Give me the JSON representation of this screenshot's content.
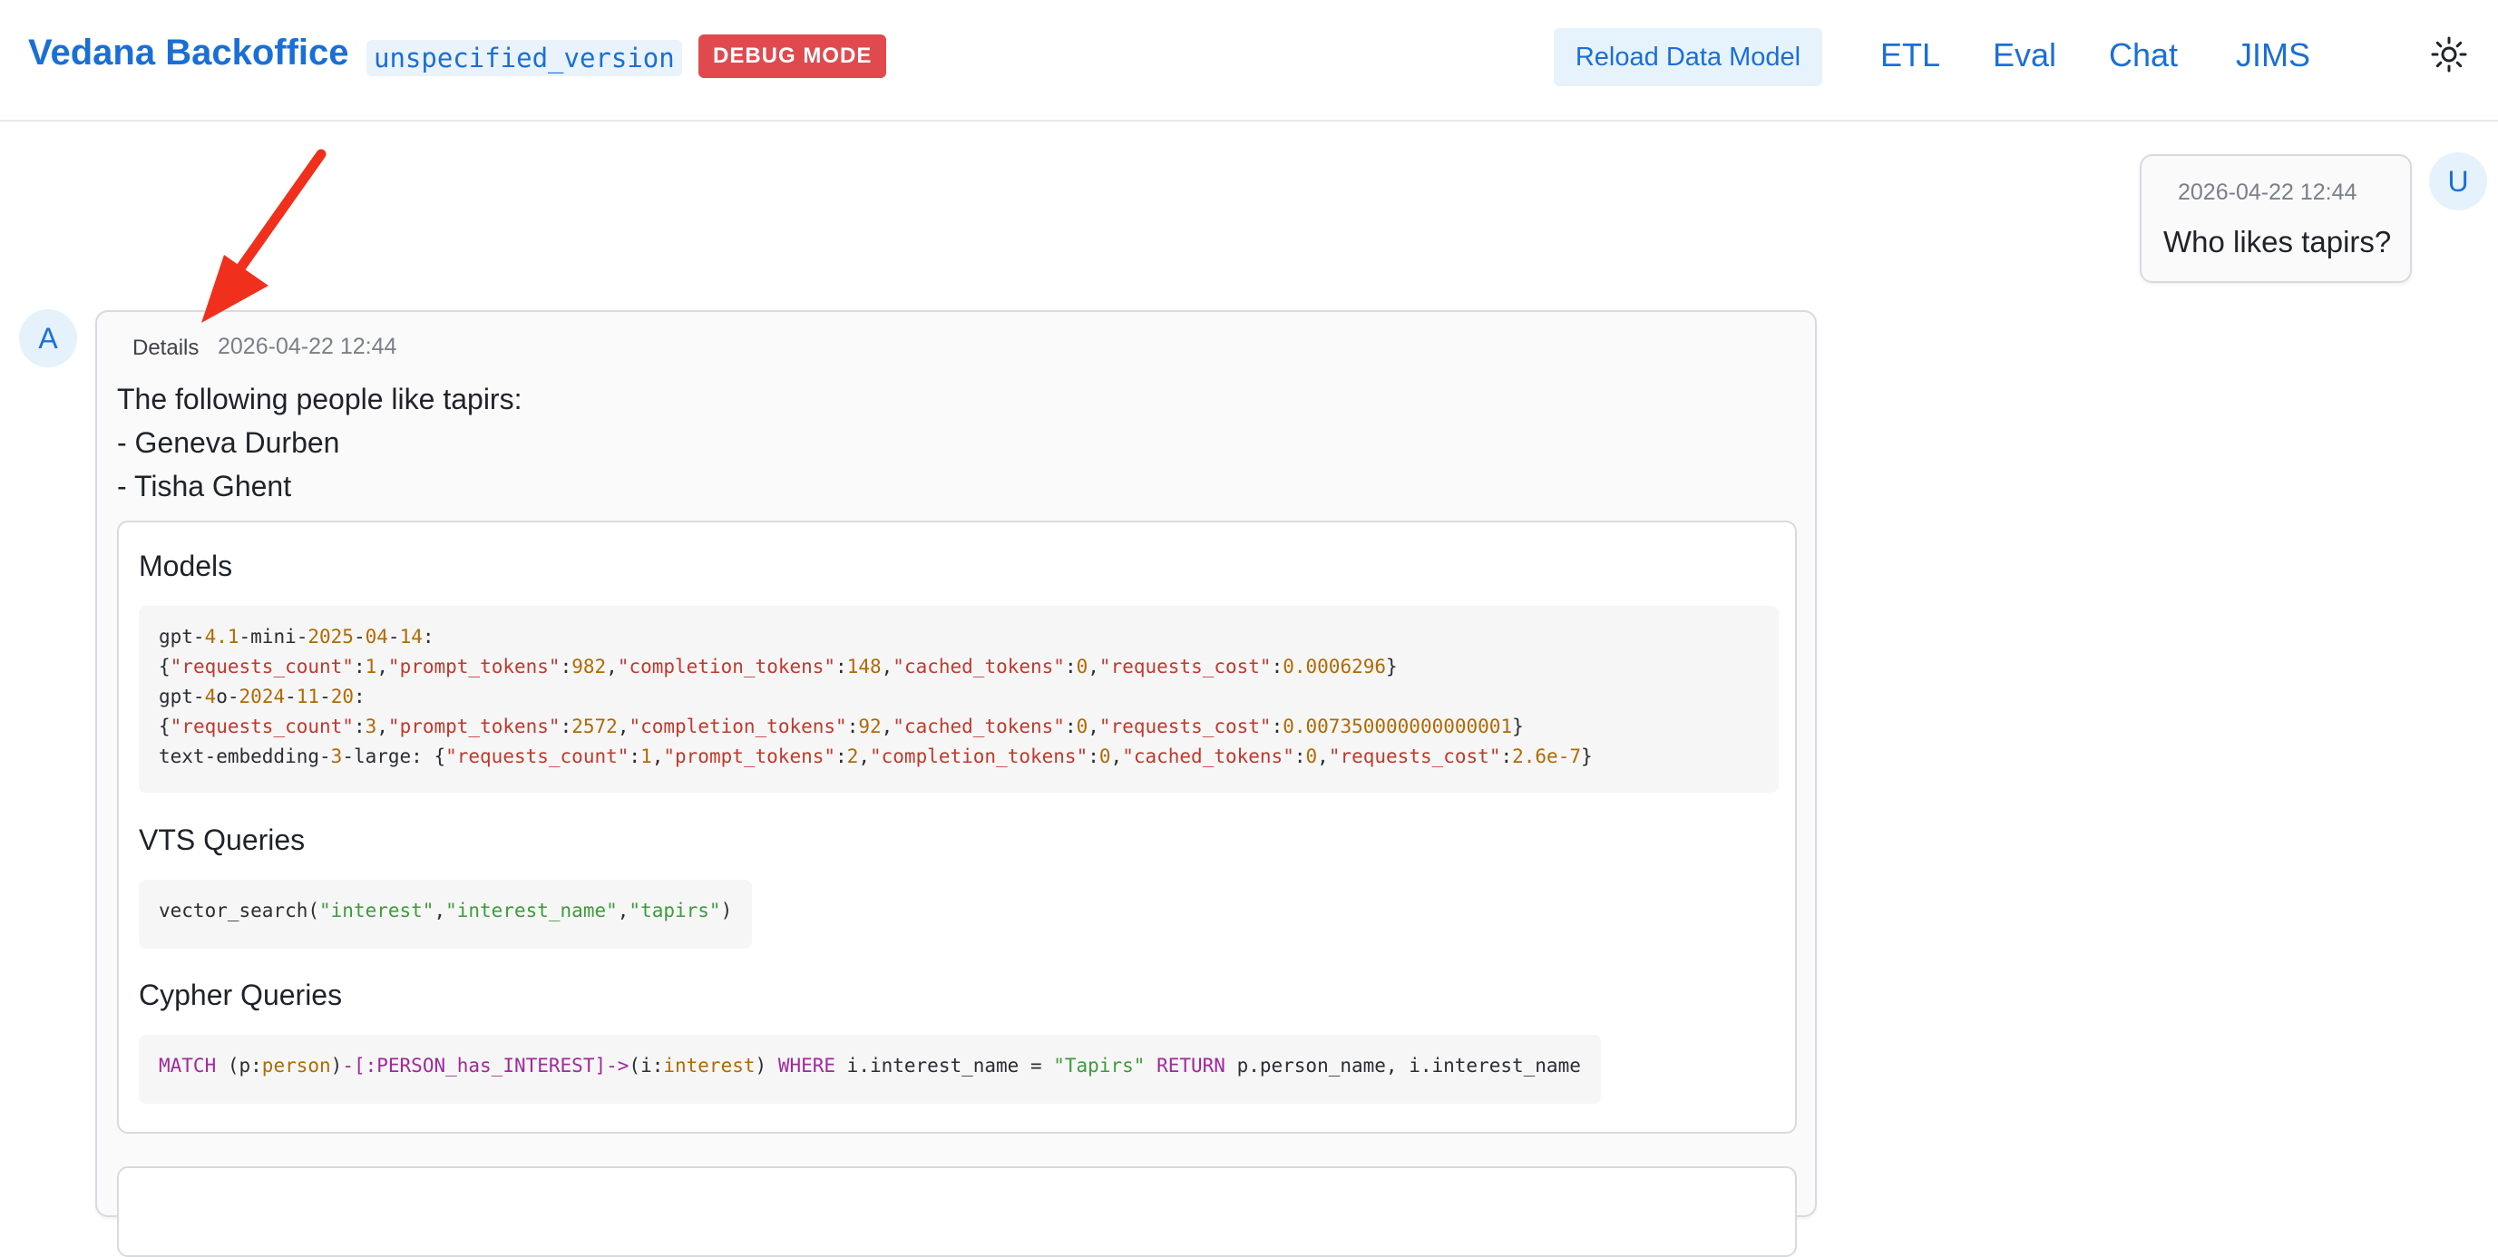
{
  "header": {
    "brand": "Vedana Backoffice",
    "version": "unspecified_version",
    "debug_badge": "DEBUG MODE",
    "reload_button": "Reload Data Model",
    "nav": [
      "ETL",
      "Eval",
      "Chat",
      "JIMS"
    ],
    "theme_icon": "sun-icon"
  },
  "user_message": {
    "avatar": "U",
    "timestamp": "2026-04-22 12:44",
    "text": "Who likes tapirs?"
  },
  "assistant_message": {
    "avatar": "A",
    "details_label": "Details",
    "timestamp": "2026-04-22 12:44",
    "answer_lines": [
      "The following people like tapirs:",
      "- Geneva Durben",
      "- Tisha Ghent"
    ],
    "sections": {
      "models_title": "Models",
      "models": [
        {
          "name": "gpt-4.1-mini-2025-04-14",
          "requests_count": 1,
          "prompt_tokens": 982,
          "completion_tokens": 148,
          "cached_tokens": 0,
          "requests_cost": "0.0006296"
        },
        {
          "name": "gpt-4o-2024-11-20",
          "requests_count": 3,
          "prompt_tokens": 2572,
          "completion_tokens": 92,
          "cached_tokens": 0,
          "requests_cost": "0.007350000000000001"
        },
        {
          "name": "text-embedding-3-large",
          "requests_count": 1,
          "prompt_tokens": 2,
          "completion_tokens": 0,
          "cached_tokens": 0,
          "requests_cost": "2.6e-7"
        }
      ],
      "vts_title": "VTS Queries",
      "vts_query": "vector_search(\"interest\",\"interest_name\",\"tapirs\")",
      "cypher_title": "Cypher Queries",
      "cypher_query": "MATCH (p:person)-[:PERSON_has_INTEREST]->(i:interest) WHERE i.interest_name = \"Tapirs\" RETURN p.person_name, i.interest_name"
    }
  },
  "annotation": {
    "arrow_color": "#f0301c"
  }
}
